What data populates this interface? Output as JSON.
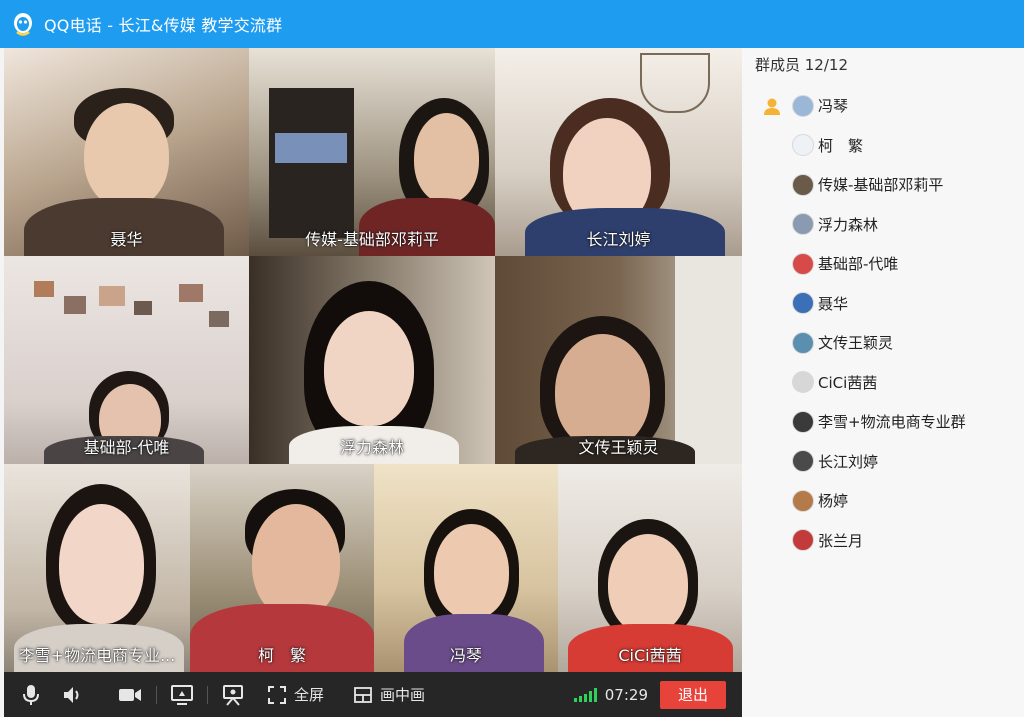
{
  "window": {
    "title": "QQ电话 - 长江&传媒 教学交流群",
    "accent": "#1e9cf0"
  },
  "video_tiles": [
    {
      "name": "聂华",
      "bg": "#c7b7a6"
    },
    {
      "name": "传媒-基础部邓莉平",
      "bg": "#8b8170"
    },
    {
      "name": "长江刘婷",
      "bg": "#d9d2c8"
    },
    {
      "name": "基础部-代唯",
      "bg": "#d8d0cc"
    },
    {
      "name": "浮力森林",
      "bg": "#7a6f62"
    },
    {
      "name": "文传王颖灵",
      "bg": "#6e5a45"
    },
    {
      "name": "李雪+物流电商专业...",
      "bg": "#c8c0b5"
    },
    {
      "name": "柯　繁",
      "bg": "#a99a86"
    },
    {
      "name": "冯琴",
      "bg": "#d9c8ac"
    },
    {
      "name": "CiCi茜茜",
      "bg": "#cfc9c2"
    }
  ],
  "controls": {
    "mic_icon": "microphone-icon",
    "speaker_icon": "speaker-icon",
    "camera_icon": "camera-icon",
    "screen_share_icon": "screen-share-icon",
    "whiteboard_icon": "presenter-icon",
    "fullscreen_label": "全屏",
    "pip_label": "画中画",
    "call_time": "07:29",
    "exit_label": "退出",
    "exit_color": "#e8433a",
    "signal_color": "#2fd15a"
  },
  "members": {
    "header": "群成员 12/12",
    "items": [
      {
        "name": "冯琴",
        "host": true,
        "avatar_color": "#9bb7d8"
      },
      {
        "name": "柯　繁",
        "host": false,
        "avatar_color": "#eef1f5"
      },
      {
        "name": "传媒-基础部邓莉平",
        "host": false,
        "avatar_color": "#6a5a4a"
      },
      {
        "name": "浮力森林",
        "host": false,
        "avatar_color": "#8a9ab0"
      },
      {
        "name": "基础部-代唯",
        "host": false,
        "avatar_color": "#d84a4a"
      },
      {
        "name": "聂华",
        "host": false,
        "avatar_color": "#3b6fb6"
      },
      {
        "name": "文传王颖灵",
        "host": false,
        "avatar_color": "#5b8fb0"
      },
      {
        "name": "CiCi茜茜",
        "host": false,
        "avatar_color": "#d7d7d7"
      },
      {
        "name": "李雪+物流电商专业群",
        "host": false,
        "avatar_color": "#3a3a3a"
      },
      {
        "name": "长江刘婷",
        "host": false,
        "avatar_color": "#4a4a4a"
      },
      {
        "name": "杨婷",
        "host": false,
        "avatar_color": "#b57a4a"
      },
      {
        "name": "张兰月",
        "host": false,
        "avatar_color": "#c33a3a"
      }
    ]
  }
}
